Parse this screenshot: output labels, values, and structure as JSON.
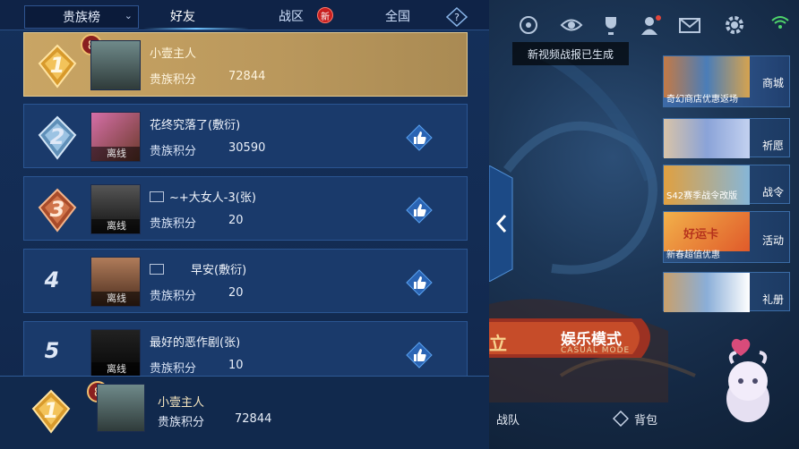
{
  "leaderboard": {
    "scope_select": "贵族榜",
    "tabs": [
      {
        "label": "好友"
      },
      {
        "label": "战区"
      },
      {
        "label": "全国"
      }
    ],
    "new_badge": "新",
    "rows": [
      {
        "rank": "1",
        "level": "8",
        "name": "小壹主人",
        "score_label": "贵族积分",
        "score": "72844",
        "offline": "",
        "highlighted": true
      },
      {
        "rank": "2",
        "level": "",
        "name": "花终究落了(敷衍)",
        "score_label": "贵族积分",
        "score": "30590",
        "offline": "离线"
      },
      {
        "rank": "3",
        "level": "",
        "name": "~+大女人-3(张)",
        "score_label": "贵族积分",
        "score": "20",
        "offline": "离线"
      },
      {
        "rank": "4",
        "level": "",
        "name": "早安(敷衍)",
        "score_label": "贵族积分",
        "score": "20",
        "offline": "离线"
      },
      {
        "rank": "5",
        "level": "",
        "name": "最好的恶作剧(张)",
        "score_label": "贵族积分",
        "score": "10",
        "offline": "离线"
      }
    ],
    "my_row": {
      "rank": "1",
      "level": "8",
      "name": "小壹主人",
      "score_label": "贵族积分",
      "score": "72844"
    }
  },
  "game": {
    "video_toast": "新视频战报已生成",
    "side_cards": [
      {
        "label": "商城",
        "caption": "奇幻商店优惠返场"
      },
      {
        "label": "祈愿",
        "caption": ""
      },
      {
        "label": "战令",
        "caption": "S42赛季战令改版"
      },
      {
        "label": "活动",
        "caption": "新春超值优惠"
      },
      {
        "label": "礼册",
        "caption": ""
      }
    ],
    "mode_label": "娱乐模式",
    "mode_sub": "CASUAL MODE",
    "partial_text": "立",
    "bottom_team": "战队",
    "bottom_bag": "背包",
    "lucky_card": "好运卡",
    "colors": {
      "accent": "#6fc3ff",
      "gold": "#c9a564",
      "panel": "#1a3a6b"
    }
  }
}
